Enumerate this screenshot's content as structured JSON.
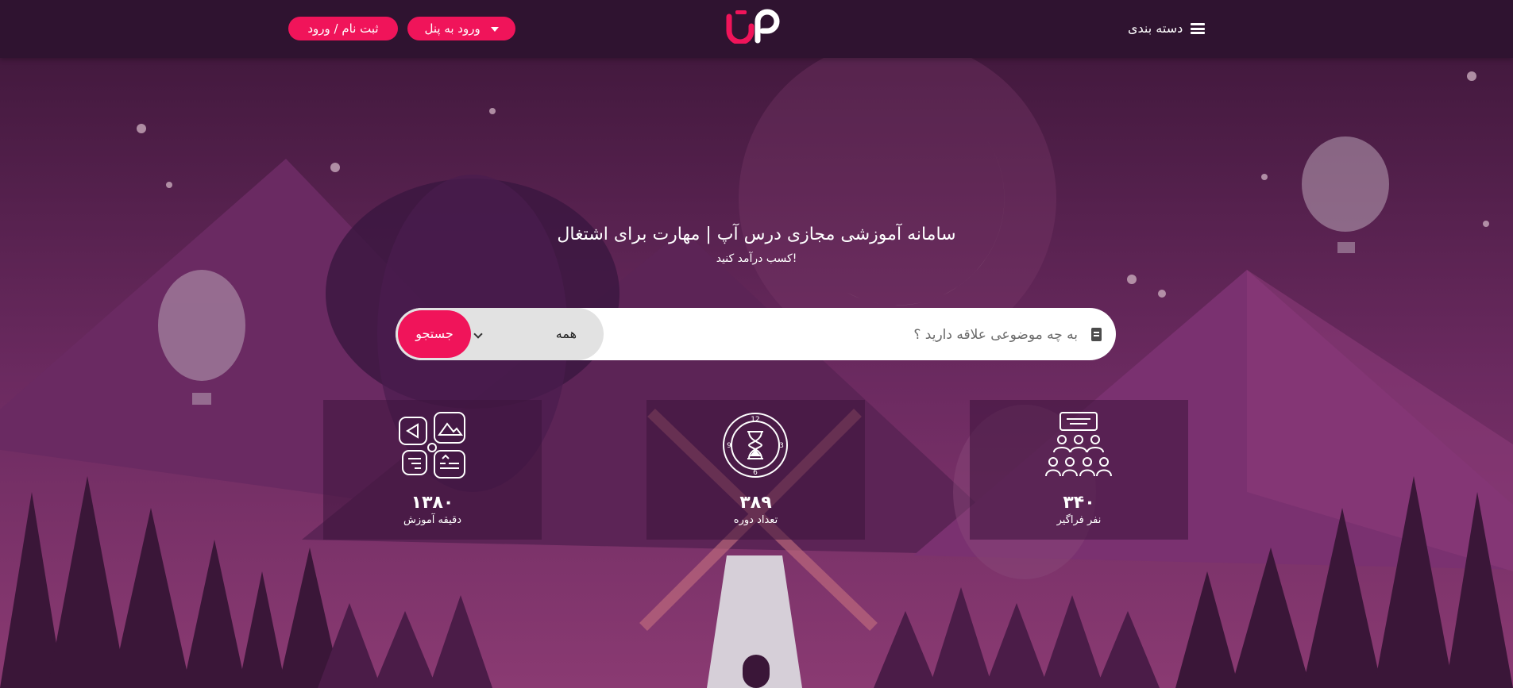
{
  "header": {
    "register_label": "ثبت نام / ورود",
    "panel_label": "ورود به پنل",
    "categories_label": "دسته بندی"
  },
  "hero": {
    "title": "سامانه آموزشی مجازی درس آپ | مهارت برای اشتغال",
    "subtitle": "کسب درآمد کنید!"
  },
  "search": {
    "placeholder": "به چه موضوعی علاقه دارید ؟",
    "select_value": "همه",
    "button_label": "جستجو"
  },
  "stats": [
    {
      "value": "۱۳۸۰",
      "label": "دقیقه آموزش",
      "icon": "shapes-icon"
    },
    {
      "value": "۳۸۹",
      "label": "تعداد دوره",
      "icon": "hourglass-clock-icon"
    },
    {
      "value": "۳۴۰",
      "label": "نفر فراگیر",
      "icon": "audience-icon"
    }
  ],
  "colors": {
    "accent": "#f0145a",
    "topbar": "#2f1330",
    "background": "#5a2352"
  }
}
